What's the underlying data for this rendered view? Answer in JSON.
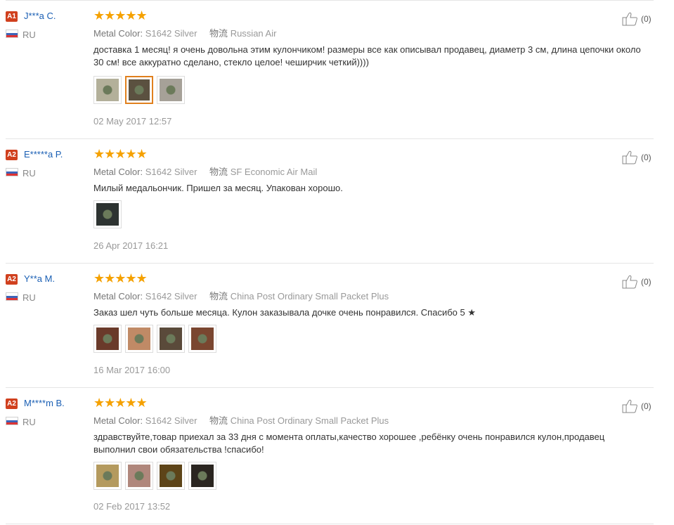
{
  "reviews": [
    {
      "level": "A1",
      "user": "J***a C.",
      "country": "RU",
      "stars": "★★★★★",
      "metal_label": "Metal Color:",
      "metal_value": "S1642 Silver",
      "ship_label": "物流",
      "ship_value": "Russian Air",
      "text": "доставка 1 месяц! я очень довольна этим кулончиком! размеры все как описывал продавец, диаметр 3 см, длина цепочки около 30 см! все аккуратно сделано, стекло целое! чеширчик четкий))))",
      "photo_colors": [
        "#b3b09a",
        "#5b5140",
        "#a6a198"
      ],
      "active_photo": 1,
      "date": "02 May 2017 12:57",
      "likes": "(0)"
    },
    {
      "level": "A2",
      "user": "E*****a P.",
      "country": "RU",
      "stars": "★★★★★",
      "metal_label": "Metal Color:",
      "metal_value": "S1642 Silver",
      "ship_label": "物流",
      "ship_value": "SF Economic Air Mail",
      "text": "Милый медальончик. Пришел за месяц. Упакован хорошо.",
      "photo_colors": [
        "#2d3331"
      ],
      "active_photo": -1,
      "date": "26 Apr 2017 16:21",
      "likes": "(0)"
    },
    {
      "level": "A2",
      "user": "Y**a M.",
      "country": "RU",
      "stars": "★★★★★",
      "metal_label": "Metal Color:",
      "metal_value": "S1642 Silver",
      "ship_label": "物流",
      "ship_value": "China Post Ordinary Small Packet Plus",
      "text": "Заказ шел чуть больше месяца. Кулон заказывала дочке очень понравился. Спасибо 5 ★",
      "photo_colors": [
        "#6a3a2a",
        "#c08a66",
        "#5a4a3a",
        "#7a4630"
      ],
      "active_photo": -1,
      "date": "16 Mar 2017 16:00",
      "likes": "(0)"
    },
    {
      "level": "A2",
      "user": "M****m B.",
      "country": "RU",
      "stars": "★★★★★",
      "metal_label": "Metal Color:",
      "metal_value": "S1642 Silver",
      "ship_label": "物流",
      "ship_value": "China Post Ordinary Small Packet Plus",
      "text": "здравствуйте,товар приехал за 33 дня с момента оплаты,качество хорошее ,ребёнку очень понравился кулон,продавец выполнил свои обязательства !спасибо!",
      "photo_colors": [
        "#b49a5e",
        "#b0877c",
        "#5d4418",
        "#2a2520"
      ],
      "active_photo": -1,
      "date": "02 Feb 2017 13:52",
      "likes": "(0)"
    }
  ]
}
